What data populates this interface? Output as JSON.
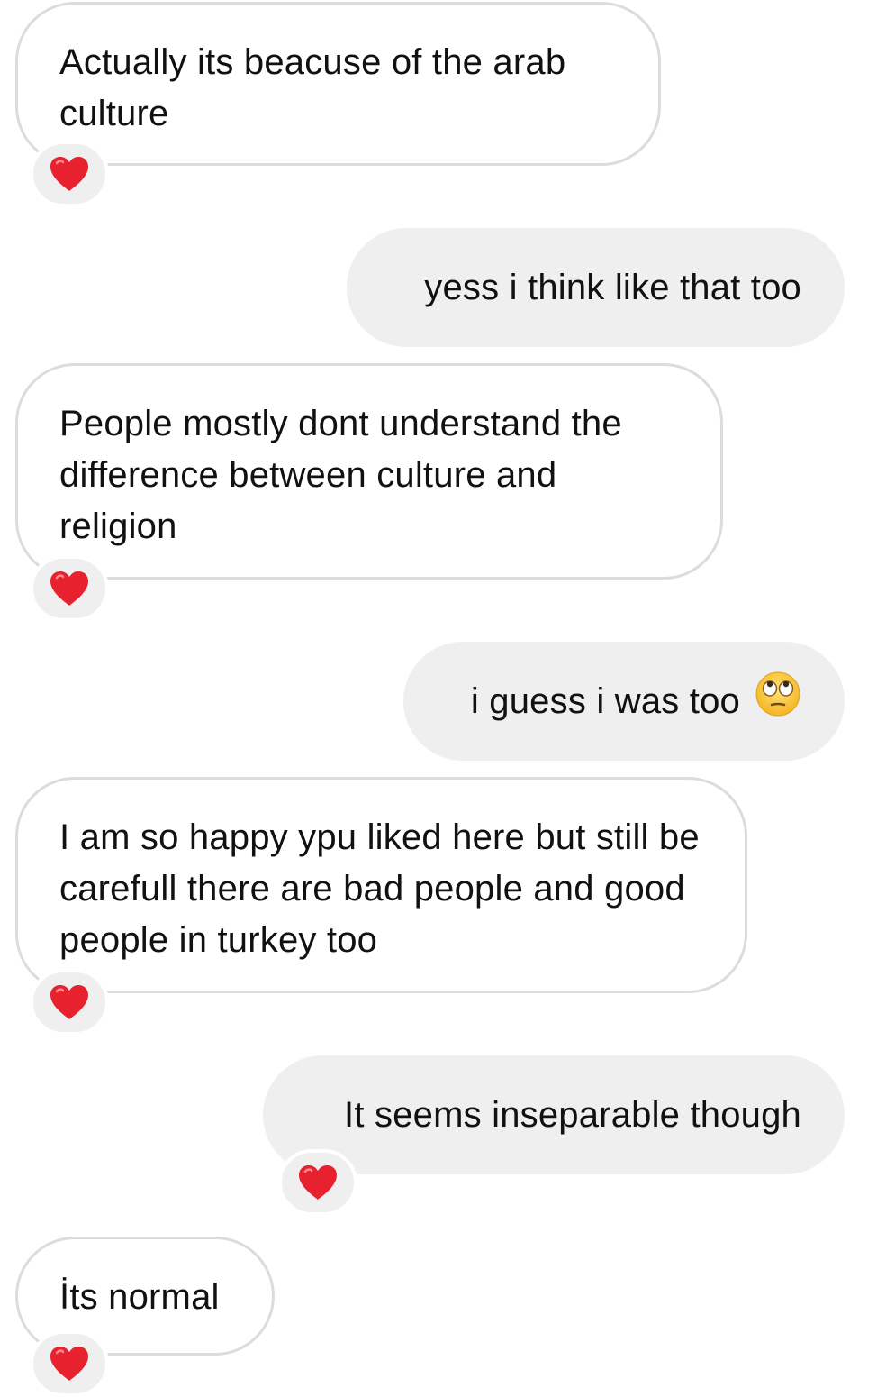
{
  "messages": [
    {
      "id": "m1",
      "sender": "other",
      "text": "Actually its beacuse of the arab culture",
      "reaction": "heart-icon"
    },
    {
      "id": "m2",
      "sender": "me",
      "text": "yess i think like that too"
    },
    {
      "id": "m3",
      "sender": "other",
      "text": "People mostly dont understand the difference between culture and religion",
      "reaction": "heart-icon"
    },
    {
      "id": "m4",
      "sender": "me",
      "text": "i guess i was too",
      "emoji": "face-with-rolling-eyes-icon"
    },
    {
      "id": "m5",
      "sender": "other",
      "text": "I am so happy ypu liked here but still be carefull there are bad people and good people in turkey too",
      "reaction": "heart-icon"
    },
    {
      "id": "m6",
      "sender": "me",
      "text": "It seems inseparable though",
      "reaction": "heart-icon"
    },
    {
      "id": "m7",
      "sender": "other",
      "text": "İts normal",
      "reaction": "heart-icon"
    }
  ],
  "colors": {
    "incoming_bubble": "#ffffff",
    "incoming_border": "#dcdcdc",
    "outgoing_bubble": "#efefef",
    "reaction_bg": "#efefef",
    "heart": "#e8212e",
    "text": "#111111"
  }
}
